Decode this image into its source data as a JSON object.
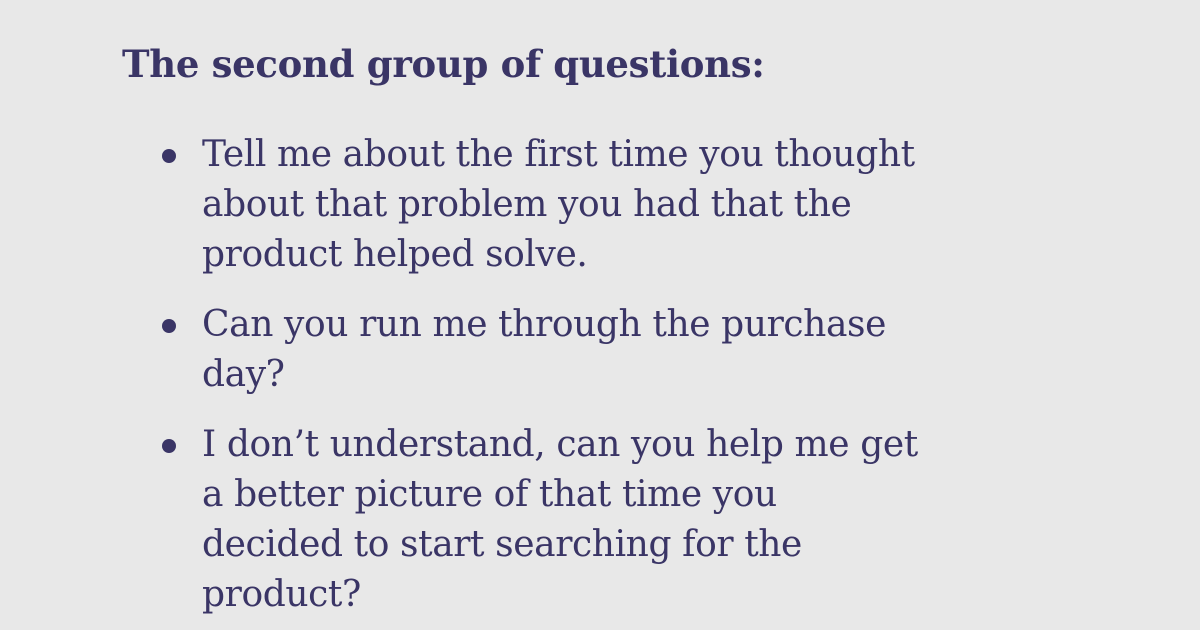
{
  "heading": "The second group of questions:",
  "bullets": [
    {
      "lines": [
        "Tell me about the first time you thought",
        "about that problem you had that the",
        "product helped solve."
      ]
    },
    {
      "lines": [
        "Can you run me through the purchase",
        "day?"
      ]
    },
    {
      "lines": [
        "I don’t understand, can you help me get",
        "a better picture of that time you",
        "decided to start searching for the",
        "product?"
      ]
    }
  ],
  "colors": {
    "background": "#e8e8e8",
    "text": "#3a3566"
  }
}
